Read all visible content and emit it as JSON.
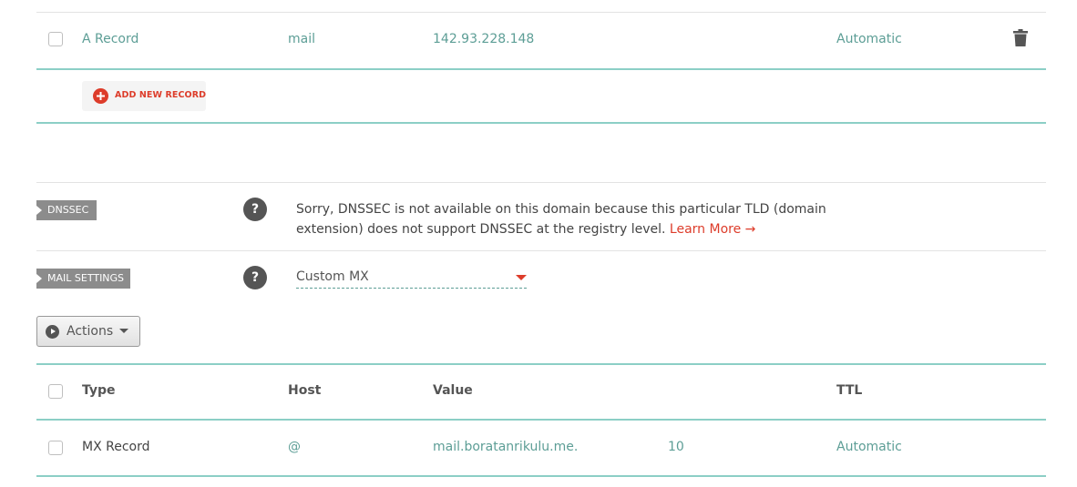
{
  "a_record": {
    "type": "A Record",
    "host": "mail",
    "value": "142.93.228.148",
    "ttl": "Automatic"
  },
  "add_new_record_label": "ADD NEW RECORD",
  "dnssec": {
    "label": "DNSSEC",
    "help": "?",
    "message": "Sorry, DNSSEC is not available on this domain because this particular TLD (domain extension) does not support DNSSEC at the registry level.",
    "learn_more": "Learn More →"
  },
  "mail_settings": {
    "label": "MAIL SETTINGS",
    "help": "?",
    "selected": "Custom MX"
  },
  "actions_label": "Actions",
  "mx_table": {
    "headers": {
      "type": "Type",
      "host": "Host",
      "value": "Value",
      "ttl": "TTL"
    },
    "rows": [
      {
        "type": "MX Record",
        "host": "@",
        "value": "mail.boratanrikulu.me.",
        "priority": "10",
        "ttl": "Automatic"
      }
    ]
  },
  "colors": {
    "accent_red": "#dd3c2a",
    "teal": "#5d9e96",
    "teal_border": "#8ccfc6",
    "tag_gray": "#8c8c8c"
  },
  "icons": [
    "trash-icon",
    "plus-circle-icon",
    "help-icon",
    "play-circle-icon",
    "caret-down-icon"
  ]
}
